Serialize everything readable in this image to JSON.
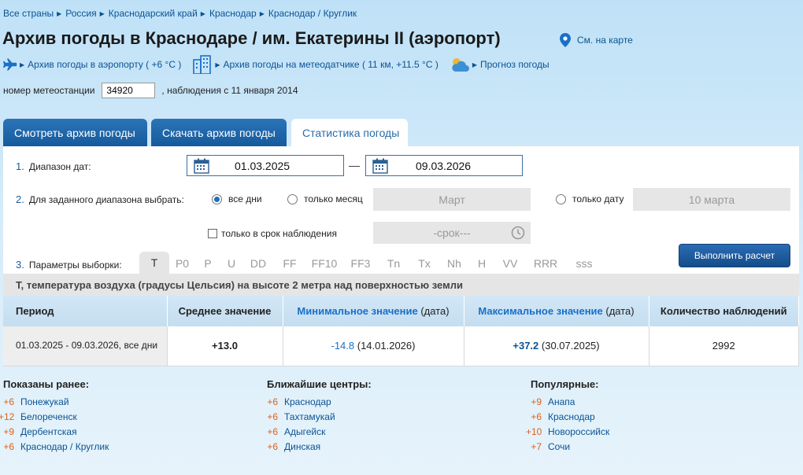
{
  "breadcrumb": [
    "Все страны",
    "Россия",
    "Краснодарский край",
    "Краснодар",
    "Краснодар / Круглик"
  ],
  "page": {
    "title": "Архив погоды в Краснодаре / им. Екатерины II (аэропорт)",
    "map_link": "См. на карте"
  },
  "links": {
    "airport": "Архив погоды в аэропорту ( +6 °C )",
    "sensor": "Архив погоды на метеодатчике ( 11 км, +11.5 °C )",
    "forecast": "Прогноз погоды"
  },
  "station": {
    "label": "номер метеостанции",
    "number": "34920",
    "since": ", наблюдения с 11 января 2014"
  },
  "tabs": [
    {
      "label": "Смотреть архив погоды"
    },
    {
      "label": "Скачать архив погоды"
    },
    {
      "label": "Статистика погоды"
    }
  ],
  "form": {
    "row1_num": "1.",
    "row1_label": "Диапазон дат:",
    "date_from": "01.03.2025",
    "date_sep": "—",
    "date_to": "09.03.2026",
    "row2_num": "2.",
    "row2_label": "Для заданного диапазона выбрать:",
    "opt_all": "все дни",
    "opt_month": "только месяц",
    "month_value": "Март",
    "opt_date": "только дату",
    "date_value": "10 марта",
    "opt_term": "только в срок наблюдения",
    "term_value": "-срок---",
    "row3_num": "3.",
    "row3_label": "Параметры выборки:",
    "params": [
      "T",
      "P0",
      "P",
      "U",
      "DD",
      "FF",
      "FF10",
      "FF3",
      "Tn",
      "Tx",
      "Nh",
      "H",
      "VV",
      "RRR",
      "sss"
    ],
    "run_button": "Выполнить расчет",
    "param_description": "T, температура воздуха (градусы Цельсия) на высоте 2 метра над поверхностью земли"
  },
  "table": {
    "headers": {
      "period": "Период",
      "avg": "Среднее значение",
      "min_link": "Минимальное значение",
      "min_suffix": " (дата)",
      "max_link": "Максимальное значение",
      "max_suffix": " (дата)",
      "count": "Количество наблюдений"
    },
    "row": {
      "period": "01.03.2025 - 09.03.2026, все дни",
      "avg": "+13.0",
      "min_value": "-14.8",
      "min_date": " (14.01.2026)",
      "max_value": "+37.2",
      "max_date": " (30.07.2025)",
      "count": "2992"
    }
  },
  "lists": {
    "recent": {
      "title": "Показаны ранее:",
      "items": [
        {
          "temp": "+6",
          "name": "Понежукай"
        },
        {
          "temp": "+12",
          "name": "Белореченск"
        },
        {
          "temp": "+9",
          "name": "Дербентская"
        },
        {
          "temp": "+6",
          "name": "Краснодар / Круглик"
        }
      ]
    },
    "nearby": {
      "title": "Ближайшие центры:",
      "items": [
        {
          "temp": "+6",
          "name": "Краснодар"
        },
        {
          "temp": "+6",
          "name": "Тахтамукай"
        },
        {
          "temp": "+6",
          "name": "Адыгейск"
        },
        {
          "temp": "+6",
          "name": "Динская"
        }
      ]
    },
    "popular": {
      "title": "Популярные:",
      "items": [
        {
          "temp": "+9",
          "name": "Анапа"
        },
        {
          "temp": "+6",
          "name": "Краснодар"
        },
        {
          "temp": "+10",
          "name": "Новороссийск"
        },
        {
          "temp": "+7",
          "name": "Сочи"
        }
      ]
    }
  },
  "colors": {
    "link": "#0b5394",
    "tab_dark": "#155a9c",
    "accent_blue": "#1a6fc9",
    "temp_orange": "#e0601a"
  },
  "icons": [
    "map-pin-icon",
    "plane-icon",
    "building-icon",
    "weather-cloud-icon",
    "calendar-icon",
    "clock-icon"
  ]
}
